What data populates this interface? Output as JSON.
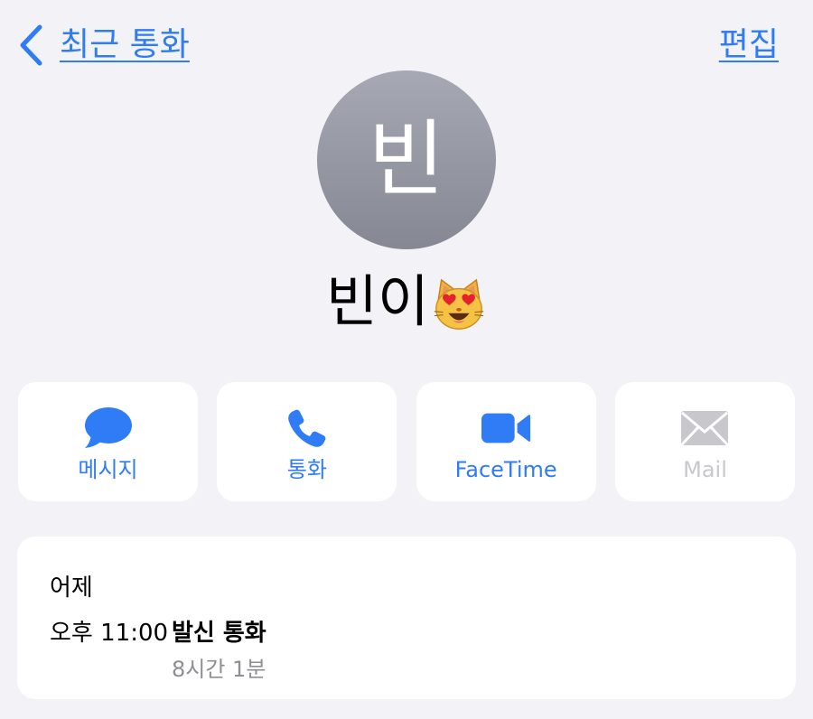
{
  "nav": {
    "back_label": "최근 통화",
    "edit_label": "편집"
  },
  "contact": {
    "avatar_initial": "빈",
    "name": "빈이",
    "emoji": "smiling-cat-heart-eyes-emoji"
  },
  "actions": [
    {
      "label": "메시지",
      "icon": "message-bubble-icon",
      "enabled": true
    },
    {
      "label": "통화",
      "icon": "phone-icon",
      "enabled": true
    },
    {
      "label": "FaceTime",
      "icon": "video-camera-icon",
      "enabled": true
    },
    {
      "label": "Mail",
      "icon": "envelope-icon",
      "enabled": false
    }
  ],
  "history": {
    "date": "어제",
    "time": "오후 11:00",
    "call_type": "발신 통화",
    "duration": "8시간 1분"
  },
  "colors": {
    "background": "#f2f2f7",
    "accent": "#2f7cf6",
    "disabled": "#c7c7cc",
    "secondary_text": "#8e8e93"
  }
}
